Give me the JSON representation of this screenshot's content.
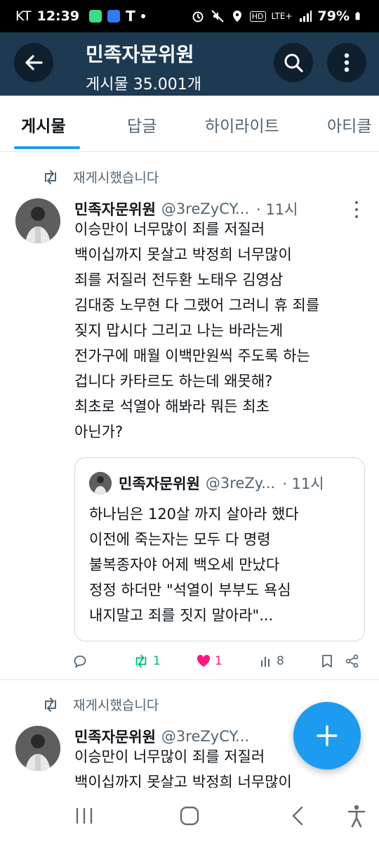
{
  "status_bar": {
    "carrier": "KT",
    "time": "12:39",
    "network": "LTE+",
    "battery": "79%"
  },
  "header": {
    "title": "민족자문위원",
    "post_count": "게시물 35.001개",
    "bg_color": "#1d3a52"
  },
  "tabs": [
    {
      "label": "게시물",
      "active": true
    },
    {
      "label": "답글",
      "active": false
    },
    {
      "label": "하이라이트",
      "active": false
    },
    {
      "label": "아티클",
      "active": false
    }
  ],
  "tweets": [
    {
      "repost_label": "재게시했습니다",
      "name": "민족자문위원",
      "handle": "@3reZyCY...",
      "time": "· 11시",
      "text_lines": [
        "이승만이 너무많이 죄를 저질러",
        "백이십까지 못살고 박정희 너무많이",
        "죄를 저질러 전두환 노태우 김영삼",
        "김대중 노무현 다 그랬어  그러니 휴 죄를",
        "짖지 맙시다  그리고 나는 바라는게",
        "전가구에 매월 이백만원씩 주도록 하는",
        "겁니다 카타르도 하는데 왜못해?",
        "최초로 석열아 해봐라 뭐든 최초",
        "아닌가?"
      ],
      "quote": {
        "name": "민족자문위원",
        "handle": "@3reZy...",
        "time": "· 11시",
        "text_lines": [
          "하나님은 120살 까지 살아라 했다",
          "이전에 죽는자는 모두 다 명령",
          "불복종자야   어제 백오세 만났다",
          "정정 하더만 \"석열이 부부도 욕심",
          "내지말고 죄를 짓지 말아라\"..."
        ]
      },
      "actions": {
        "reposts": "1",
        "likes": "1",
        "views": "8"
      }
    },
    {
      "repost_label": "재게시했습니다",
      "name": "민족자문위원",
      "handle": "@3reZyCY...",
      "text_lines": [
        "이승만이 너무많이 죄를 저질러",
        "백이십까지 못살고 박정희 너무많이"
      ]
    }
  ],
  "colors": {
    "accent": "#1d9bf0",
    "repost_green": "#00ba7c",
    "like_pink": "#f91880",
    "muted": "#536471"
  }
}
